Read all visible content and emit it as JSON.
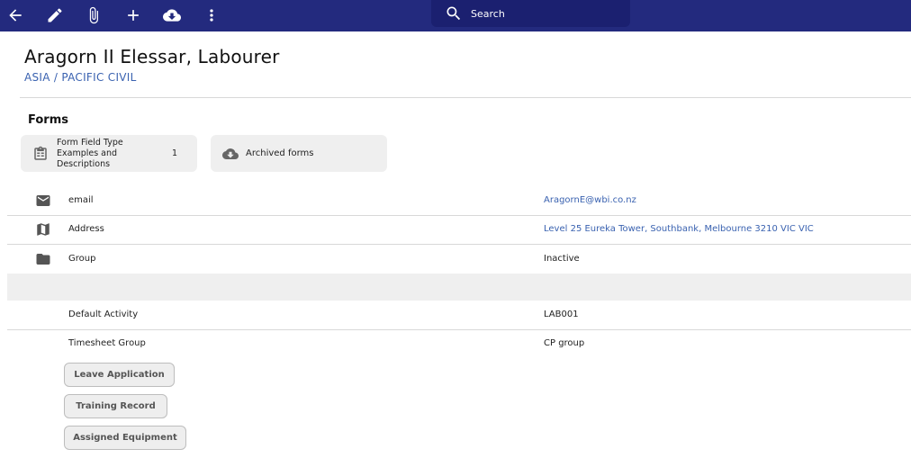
{
  "toolbar": {
    "icons": [
      "back-arrow-icon",
      "pencil-icon",
      "paperclip-icon",
      "plus-icon",
      "cloud-download-icon",
      "more-vert-icon"
    ],
    "search_placeholder": "Search"
  },
  "header": {
    "title": "Aragorn II Elessar, Labourer",
    "subtitle": "ASIA / PACIFIC CIVIL"
  },
  "forms": {
    "heading": "Forms",
    "cards": [
      {
        "label": "Form Field Type Examples and Descriptions",
        "count": "1",
        "icon": "clipboard-icon"
      },
      {
        "label": "Archived forms",
        "icon": "cloud-download-icon"
      }
    ]
  },
  "details": [
    {
      "label": "email",
      "value": "AragornE@wbi.co.nz",
      "icon": "email-icon"
    },
    {
      "label": "Address",
      "value": "Level 25 Eureka Tower, Southbank, Melbourne 3210 VIC VIC",
      "icon": "map-icon"
    },
    {
      "label": "Group",
      "value": "Inactive",
      "icon": "folder-icon"
    },
    {
      "label": "Default Activity",
      "value": "LAB001"
    },
    {
      "label": "Timesheet Group",
      "value": "CP group"
    }
  ],
  "actions": {
    "leave": "Leave Application",
    "training": "Training Record",
    "equipment": "Assigned Equipment"
  },
  "colors": {
    "topbar": "#232a7e",
    "link": "#3a62b0"
  }
}
